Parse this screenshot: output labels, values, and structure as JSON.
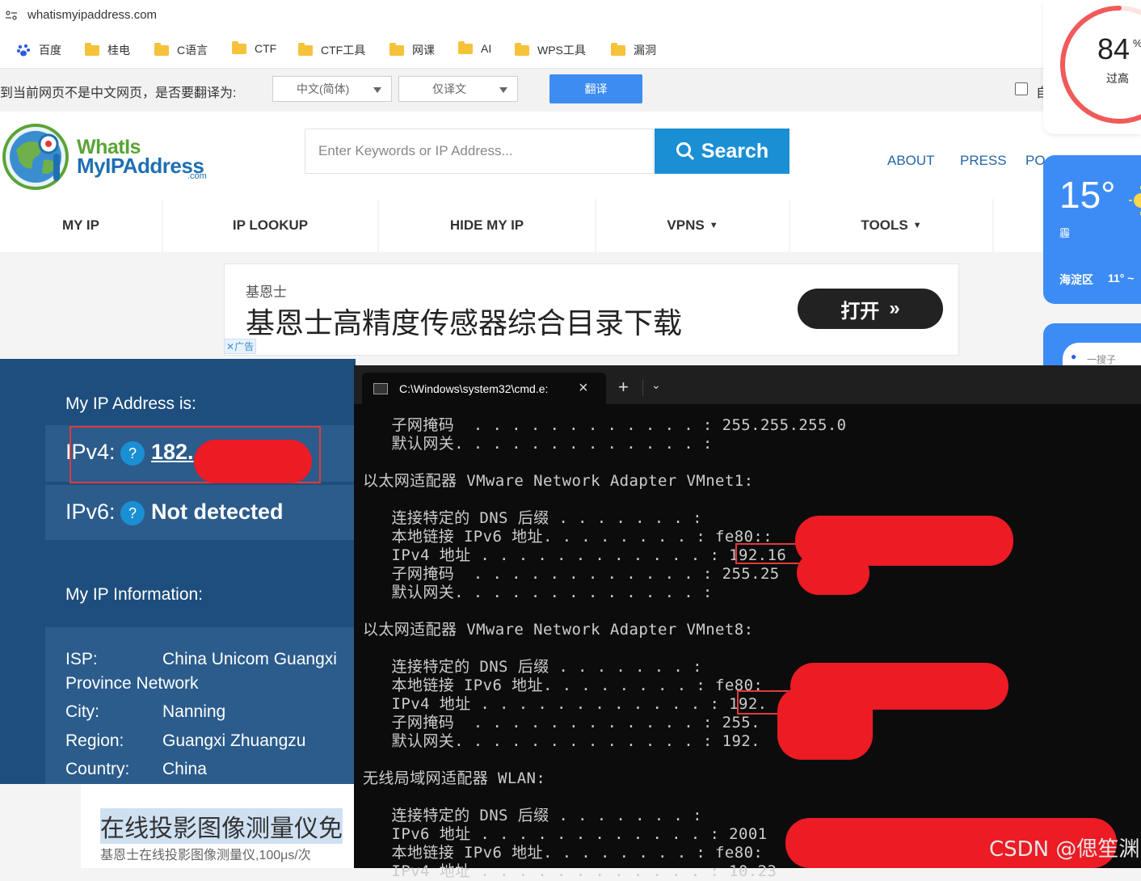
{
  "browser": {
    "url": "whatismyipaddress.com",
    "bookmarks": [
      "百度",
      "桂电",
      "C语言",
      "CTF",
      "CTF工具",
      "网课",
      "AI",
      "WPS工具",
      "漏洞"
    ],
    "translate_bar": {
      "message": "到当前网页不是中文网页，是否要翻译为:",
      "language": "中文(简体)",
      "mode": "仅译文",
      "button": "翻译",
      "checkbox_label": "自"
    }
  },
  "site": {
    "logo_line1": "WhatIs",
    "logo_line2": "MyIPAddress",
    "logo_com": ".com",
    "search_placeholder": "Enter Keywords or IP Address...",
    "search_button": "Search",
    "top_links": [
      "ABOUT",
      "PRESS",
      "PO"
    ],
    "nav": [
      "MY IP",
      "IP LOOKUP",
      "HIDE MY IP",
      "VPNS",
      "TOOLS"
    ],
    "ad": {
      "brand": "基恩士",
      "headline": "基恩士高精度传感器综合目录下载",
      "button": "打开",
      "ad_label": "广告"
    },
    "ip": {
      "heading": "My IP Address is:",
      "ipv4_label": "IPv4:",
      "ipv4_value": "182.",
      "ipv6_label": "IPv6:",
      "ipv6_value": "Not detected",
      "help": "?"
    },
    "info": {
      "heading": "My IP Information:",
      "isp_label": "ISP:",
      "isp_value_1": "China Unicom Guangxi",
      "isp_value_2": "Province Network",
      "city_label": "City:",
      "city_value": "Nanning",
      "region_label": "Region:",
      "region_value": "Guangxi Zhuangzu",
      "country_label": "Country:",
      "country_value": "China"
    },
    "below": {
      "title": "在线投影图像测量仪免",
      "subtitle": "基恩士在线投影图像测量仪,100μs/次"
    }
  },
  "widgets": {
    "humidity_value": "84",
    "humidity_unit": "%",
    "humidity_label": "过高",
    "temperature": "15°",
    "weather_icon": "sun-icon",
    "condition": "霾",
    "district": "海淀区",
    "low_temp": "11° ~",
    "third_text": "一搜子"
  },
  "terminal": {
    "tab_title": "C:\\Windows\\system32\\cmd.e:",
    "lines": [
      "   子网掩码  . . . . . . . . . . . . : 255.255.255.0",
      "   默认网关. . . . . . . . . . . . . :",
      "",
      "以太网适配器 VMware Network Adapter VMnet1:",
      "",
      "   连接特定的 DNS 后缀 . . . . . . . :",
      "   本地链接 IPv6 地址. . . . . . . . : fe80::",
      "   IPv4 地址 . . . . . . . . . . . . : 192.16",
      "   子网掩码  . . . . . . . . . . . . : 255.25",
      "   默认网关. . . . . . . . . . . . . :",
      "",
      "以太网适配器 VMware Network Adapter VMnet8:",
      "",
      "   连接特定的 DNS 后缀 . . . . . . . :",
      "   本地链接 IPv6 地址. . . . . . . . : fe80:",
      "   IPv4 地址 . . . . . . . . . . . . : 192.",
      "   子网掩码  . . . . . . . . . . . . : 255.",
      "   默认网关. . . . . . . . . . . . . : 192.",
      "",
      "无线局域网适配器 WLAN:",
      "",
      "   连接特定的 DNS 后缀 . . . . . . . :",
      "   IPv6 地址 . . . . . . . . . . . . : 2001",
      "   本地链接 IPv6 地址. . . . . . . . : fe80:",
      "   IPv4 地址 . . . . . . . . . . . . : 10.23"
    ]
  },
  "watermark": "CSDN @偲笙渊",
  "colors": {
    "site_blue": "#1d4e7d",
    "search_blue": "#1b8fd4",
    "redaction": "#ec1b24",
    "terminal_bg": "#0c0c0c"
  }
}
